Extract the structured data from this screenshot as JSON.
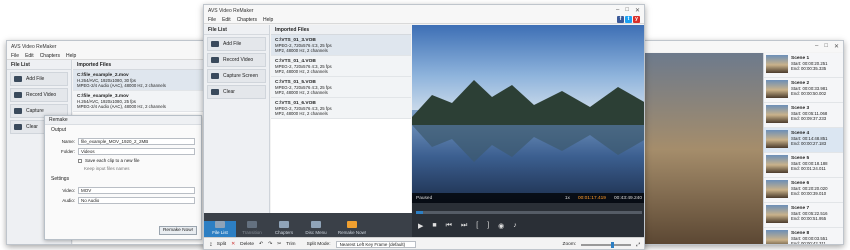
{
  "left_window": {
    "title": "AVS Video ReMaker",
    "menu": [
      "File",
      "Edit",
      "Chapters",
      "Help"
    ],
    "file_list_label": "File List",
    "imported_label": "Imported Files",
    "buttons": [
      "Add File",
      "Record Video",
      "Capture",
      "Clear"
    ],
    "files": [
      {
        "name": "C:\\file_example_2.mov",
        "line1": "H.264/AVC, 1920x1080, 30 fps",
        "line2": "MPEG-2/4 Audio (AAC), 48000 Hz, 2 channels"
      },
      {
        "name": "C:\\file_example_3.mov",
        "line1": "H.264/AVC, 1920x1080, 25 fps",
        "line2": "MPEG-2/4 Audio (AAC), 48000 Hz, 2 channels"
      }
    ]
  },
  "remake_dialog": {
    "title": "Remake",
    "output_label": "Output",
    "name_label": "Name:",
    "name_value": "file_example_MOV_1920_2_2MB",
    "folder_label": "Folder:",
    "folder_value": "Videos",
    "save_each_label": "Save each clip to a new file",
    "keep_names_label": "Keep input files names",
    "settings_label": "Settings",
    "video_label": "Video:",
    "video_value": "MOV",
    "audio_label": "Audio:",
    "audio_value": "No Audio",
    "remake_button": "Remake Now!"
  },
  "main_window": {
    "title": "AVS Video ReMaker",
    "menu": [
      "File",
      "Edit",
      "Chapters",
      "Help"
    ],
    "social": [
      "f",
      "t",
      "y"
    ],
    "file_list_label": "File List",
    "imported_label": "Imported Files",
    "buttons": [
      "Add File",
      "Record Video",
      "Capture Screen",
      "Clear"
    ],
    "files": [
      {
        "name": "C:\\VTS_01_3.VOB",
        "line1": "MPEG-2, 720x576 4:3, 25 fps",
        "line2": "MP2, 48000 Hz, 2 channels"
      },
      {
        "name": "C:\\VTS_01_4.VOB",
        "line1": "MPEG-2, 720x576 4:3, 25 fps",
        "line2": "MP2, 48000 Hz, 2 channels"
      },
      {
        "name": "C:\\VTS_01_5.VOB",
        "line1": "MPEG-2, 720x576 4:3, 25 fps",
        "line2": "MP2, 48000 Hz, 2 channels"
      },
      {
        "name": "C:\\VTS_01_6.VOB",
        "line1": "MPEG-2, 720x576 4:3, 25 fps",
        "line2": "MP2, 48000 Hz, 2 channels"
      }
    ],
    "status": "Paused",
    "speed": "1x",
    "time_current": "00:01:17.419",
    "time_total": "00:43:49.240",
    "tools": [
      "File List",
      "Transition",
      "Chapters",
      "Disc Menu",
      "Remake Now!"
    ],
    "bottom": {
      "split": "Split",
      "delete": "Delete",
      "trim": "Trim",
      "split_mode_label": "Split Mode:",
      "split_mode_value": "Nearest Left Key Frame (default)",
      "zoom_label": "Zoom:"
    }
  },
  "scenes": [
    {
      "name": "Scene 1",
      "start": "Start: 00:00:20.251",
      "end": "End: 00:00:35.335"
    },
    {
      "name": "Scene 2",
      "start": "Start: 00:00:33.981",
      "end": "End: 00:00:50.002"
    },
    {
      "name": "Scene 3",
      "start": "Start: 00:05:11.068",
      "end": "End: 00:09:37.233"
    },
    {
      "name": "Scene 4",
      "start": "Start: 00:14:48.851",
      "end": "End: 00:00:27.183"
    },
    {
      "name": "Scene 5",
      "start": "Start: 00:00:18.188",
      "end": "End: 00:01:24.011"
    },
    {
      "name": "Scene 6",
      "start": "Start: 00:20:20.020",
      "end": "End: 00:00:39.010"
    },
    {
      "name": "Scene 7",
      "start": "Start: 00:05:22.516",
      "end": "End: 00:00:51.955"
    },
    {
      "name": "Scene 8",
      "start": "Start: 00:00:03.551",
      "end": "End: 00:00:42.311"
    }
  ]
}
